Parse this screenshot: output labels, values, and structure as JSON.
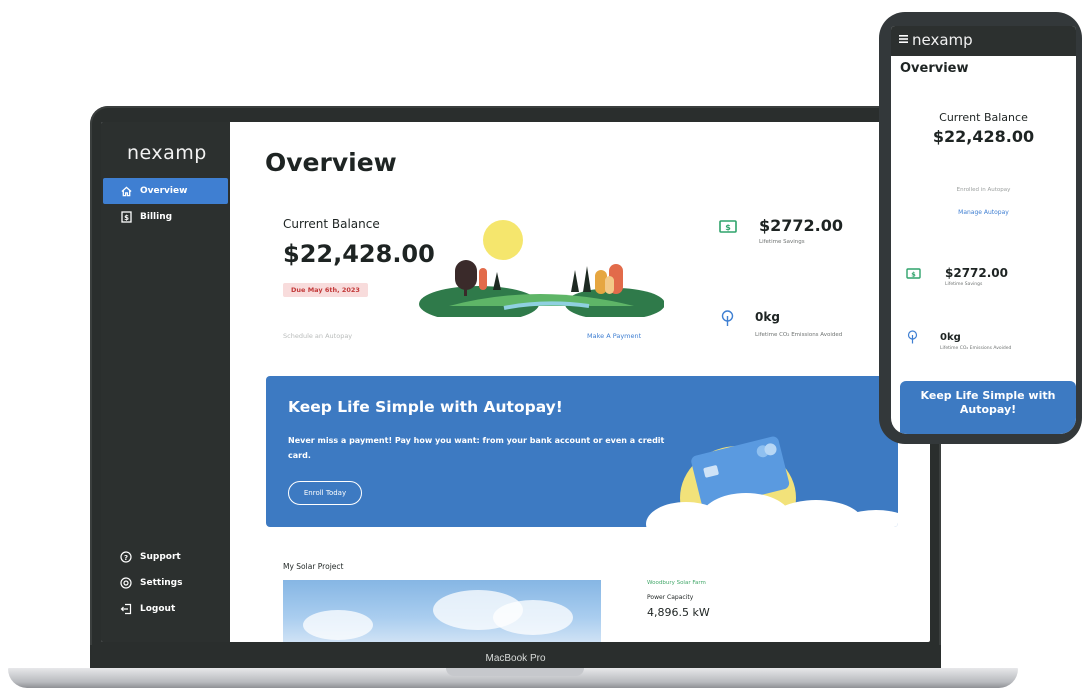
{
  "laptop": {
    "brand": "MacBook Pro",
    "logo": "nexamp",
    "nav": [
      {
        "label": "Overview",
        "icon": "home-icon",
        "active": true
      },
      {
        "label": "Billing",
        "icon": "billing-icon",
        "active": false
      }
    ],
    "bottom_nav": [
      {
        "label": "Support",
        "icon": "help-icon"
      },
      {
        "label": "Settings",
        "icon": "gear-icon"
      },
      {
        "label": "Logout",
        "icon": "logout-icon"
      }
    ],
    "page_title": "Overview",
    "balance": {
      "label": "Current Balance",
      "amount": "$22,428.00",
      "due": "Due May 6th, 2023",
      "autopay_text": "Schedule an Autopay",
      "payment_link": "Make A Payment"
    },
    "stats": [
      {
        "value": "$2772.00",
        "label": "Lifetime Savings",
        "icon": "money-icon"
      },
      {
        "value": "0kg",
        "label": "Lifetime CO₂ Emissions Avoided",
        "icon": "tree-icon"
      }
    ],
    "banner": {
      "title": "Keep Life Simple with Autopay!",
      "body": "Never miss a payment! Pay how you want: from your bank account or even a credit card.",
      "button": "Enroll Today"
    },
    "solar": {
      "section_label": "My Solar Project",
      "site_name": "Woodbury Solar Farm",
      "power_label": "Power Capacity",
      "power_value": "4,896.5 kW"
    }
  },
  "phone": {
    "logo": "nexamp",
    "title": "Overview",
    "balance_label": "Current Balance",
    "balance_amount": "$22,428.00",
    "enrolled_text": "Enrolled in Autopay",
    "manage_link": "Manage Autopay",
    "stats": [
      {
        "value": "$2772.00",
        "label": "Lifetime Savings",
        "icon": "money-icon"
      },
      {
        "value": "0kg",
        "label": "Lifetime CO₂ Emissions Avoided",
        "icon": "tree-icon"
      }
    ],
    "banner_title": "Keep Life Simple with Autopay!"
  },
  "colors": {
    "accent": "#3f7fd2",
    "banner": "#3d7ac2",
    "sidebar": "#2c302f",
    "savings_green": "#2fa36b",
    "due_red": "#c33a3a"
  }
}
